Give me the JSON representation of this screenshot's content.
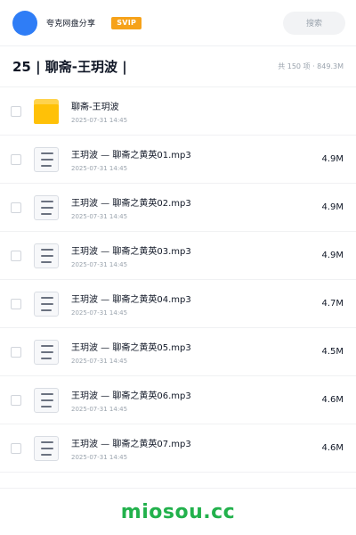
{
  "header": {
    "brand": "夸克网盘分享",
    "badge": "SVIP",
    "search_placeholder": "搜索"
  },
  "title_row": {
    "title": "25 | 聊斋-王玥波 |",
    "meta": "共 150 项 · 849.3M"
  },
  "items": [
    {
      "type": "folder",
      "name": "聊斋-王玥波",
      "date": "2025-07-31 14:45",
      "size": ""
    },
    {
      "type": "file",
      "name": "王玥波 — 聊斋之黄英01.mp3",
      "date": "2025-07-31 14:45",
      "size": "4.9M"
    },
    {
      "type": "file",
      "name": "王玥波 — 聊斋之黄英02.mp3",
      "date": "2025-07-31 14:45",
      "size": "4.9M"
    },
    {
      "type": "file",
      "name": "王玥波 — 聊斋之黄英03.mp3",
      "date": "2025-07-31 14:45",
      "size": "4.9M"
    },
    {
      "type": "file",
      "name": "王玥波 — 聊斋之黄英04.mp3",
      "date": "2025-07-31 14:45",
      "size": "4.7M"
    },
    {
      "type": "file",
      "name": "王玥波 — 聊斋之黄英05.mp3",
      "date": "2025-07-31 14:45",
      "size": "4.5M"
    },
    {
      "type": "file",
      "name": "王玥波 — 聊斋之黄英06.mp3",
      "date": "2025-07-31 14:45",
      "size": "4.6M"
    },
    {
      "type": "file",
      "name": "王玥波 — 聊斋之黄英07.mp3",
      "date": "2025-07-31 14:45",
      "size": "4.6M"
    }
  ],
  "footer": {
    "watermark": "miosou.cc"
  },
  "colors": {
    "accent": "#2f7df6",
    "svip": "#f6a21a",
    "watermark": "#22b14c",
    "folder": "#ffc107"
  }
}
